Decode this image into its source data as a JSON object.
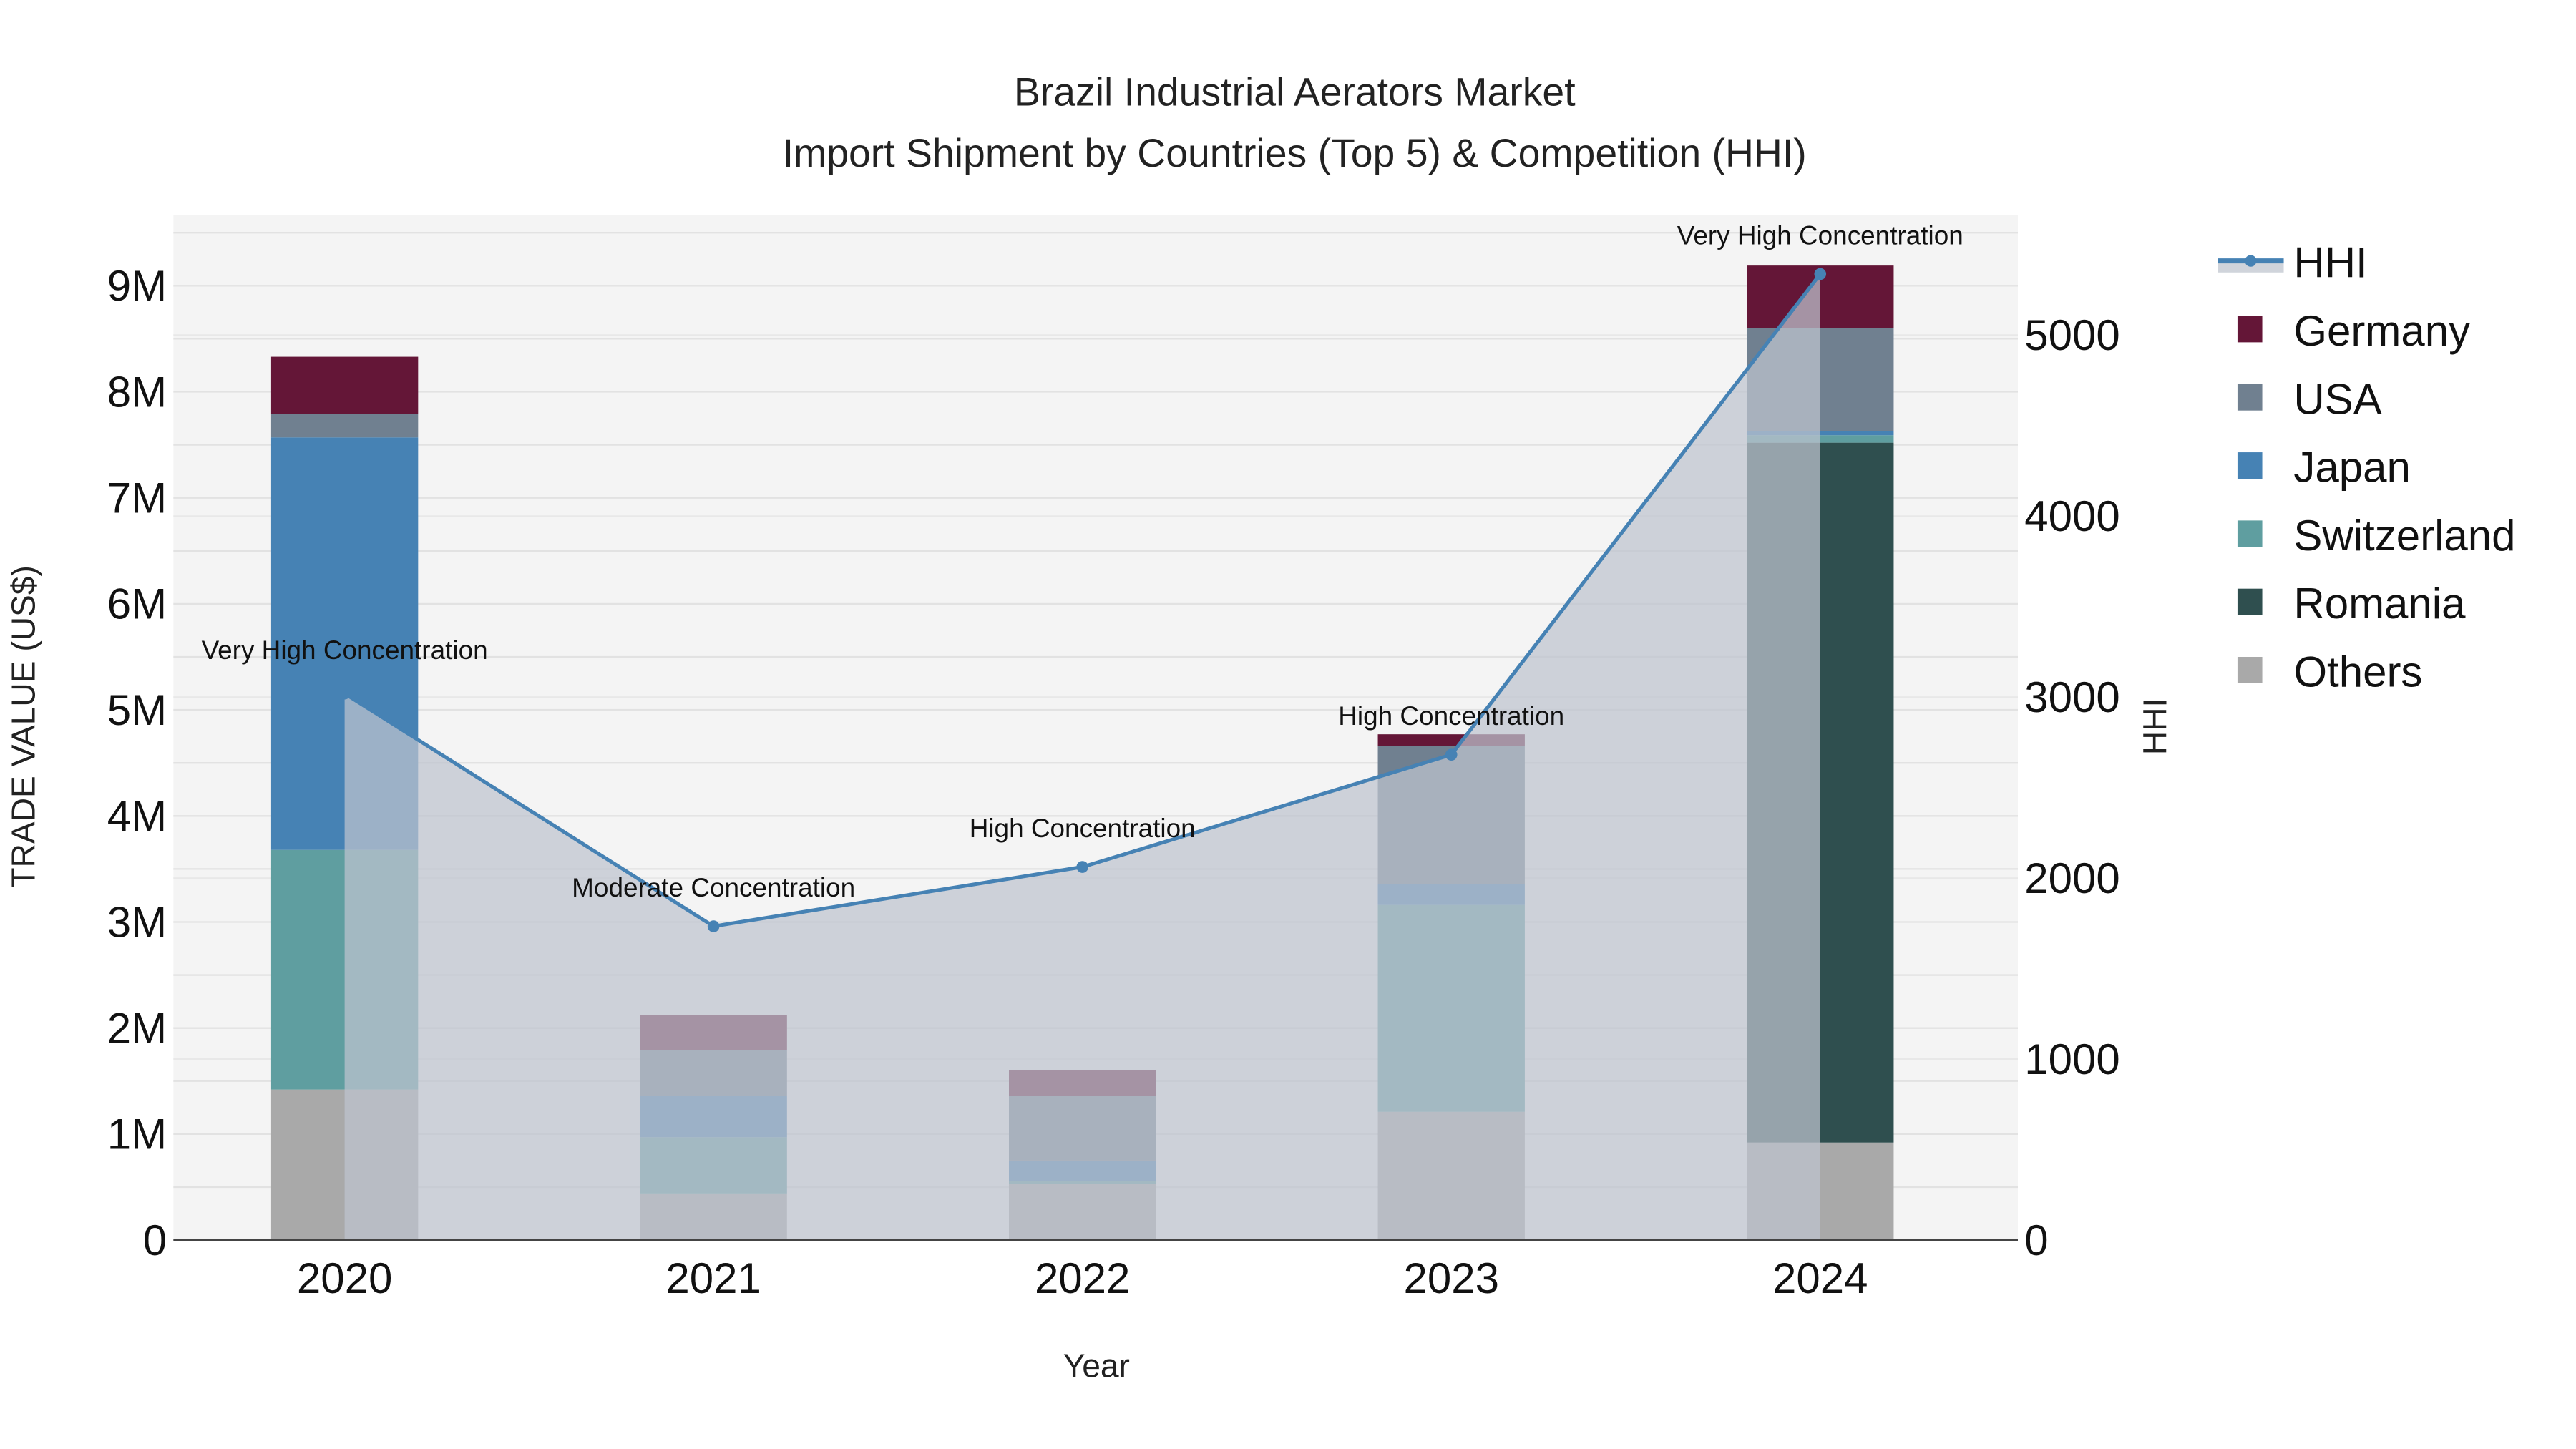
{
  "chart_data": {
    "type": "bar",
    "title": "Brazil Industrial Aerators Market",
    "subtitle": "Import Shipment by Countries (Top 5) & Competition (HHI)",
    "xlabel": "Year",
    "ylabel": "TRADE VALUE (US$)",
    "y2label": "HHI",
    "categories": [
      "2020",
      "2021",
      "2022",
      "2023",
      "2024"
    ],
    "ylim": [
      0,
      9670000
    ],
    "y2lim": [
      0,
      5666
    ],
    "yticks": [
      0,
      1000000,
      2000000,
      3000000,
      4000000,
      5000000,
      6000000,
      7000000,
      8000000,
      9000000
    ],
    "ytick_labels": [
      "0",
      "1M",
      "2M",
      "3M",
      "4M",
      "5M",
      "6M",
      "7M",
      "8M",
      "9M"
    ],
    "y2ticks": [
      0,
      1000,
      2000,
      3000,
      4000,
      5000
    ],
    "y2tick_labels": [
      "0",
      "1000",
      "2000",
      "3000",
      "4000",
      "5000"
    ],
    "grid": true,
    "legend_position": "right",
    "stack_order": [
      "Others",
      "Romania",
      "Switzerland",
      "Japan",
      "USA",
      "Germany"
    ],
    "series": [
      {
        "name": "Germany",
        "color": "#641637",
        "values": [
          540000,
          330000,
          240000,
          110000,
          590000
        ]
      },
      {
        "name": "USA",
        "color": "#708090",
        "values": [
          220000,
          430000,
          610000,
          1300000,
          970000
        ]
      },
      {
        "name": "Japan",
        "color": "#4682B4",
        "values": [
          3890000,
          390000,
          190000,
          200000,
          40000
        ]
      },
      {
        "name": "Switzerland",
        "color": "#5F9EA0",
        "values": [
          2260000,
          530000,
          30000,
          1950000,
          70000
        ]
      },
      {
        "name": "Romania",
        "color": "#2F4F4F",
        "values": [
          0,
          0,
          0,
          0,
          6600000
        ]
      },
      {
        "name": "Others",
        "color": "#A9A9A9",
        "values": [
          1420000,
          440000,
          530000,
          1210000,
          920000
        ]
      }
    ],
    "hhi": {
      "name": "HHI",
      "color": "#4682B4",
      "values": [
        3020,
        1734,
        2062,
        2682,
        5338
      ],
      "annotations": [
        "Very High Concentration",
        "Moderate Concentration",
        "High Concentration",
        "High Concentration",
        "Very High Concentration"
      ]
    },
    "legend": [
      "HHI",
      "Germany",
      "USA",
      "Japan",
      "Switzerland",
      "Romania",
      "Others"
    ]
  }
}
